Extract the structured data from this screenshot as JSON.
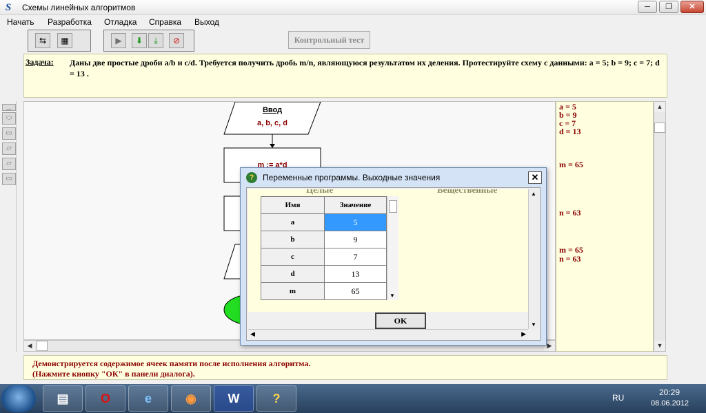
{
  "window": {
    "title": "Схемы линейных алгоритмов",
    "icon_glyph": "S",
    "minimize": "─",
    "maximize": "❐",
    "close": "✕"
  },
  "menu": [
    "Начать",
    "Разработка",
    "Отладка",
    "Справка",
    "Выход"
  ],
  "toolbar": {
    "control_test_label": "Контрольный тест",
    "icons": [
      "edit-properties-icon",
      "delete-icon",
      "run-icon",
      "step-into-icon",
      "step-over-icon",
      "stop-icon"
    ]
  },
  "task": {
    "label": "Задача:",
    "text": "Даны две простые дроби a/b и c/d. Требуется получить дробь m/n, являющуюся результатом их деления.      Протестируйте схему с данными: a = 5;  b = 9;  c = 7;  d = 13 ."
  },
  "flowchart": {
    "input_title": "Ввод",
    "input_vars": "a, b, c, d",
    "assign_m": "m := a*d"
  },
  "right_panel": {
    "a": "a = 5",
    "b": "b = 9",
    "c": "c = 7",
    "d": "d = 13",
    "m": "m = 65",
    "n": "n = 63",
    "m2": "m = 65",
    "n2": "n = 63"
  },
  "status": {
    "line1": "Демонстрируется содержимое ячеек памяти после исполнения алгоритма.",
    "line2": "(Нажмите кнопку \"ОК\" в панели диалога)."
  },
  "dialog": {
    "title": "Переменные программы. Выходные значения",
    "close": "✕",
    "group_int": "Целые",
    "group_real": "Вещественные",
    "col_name": "Имя",
    "col_value": "Значение",
    "rows": [
      {
        "name": "a",
        "value": "5"
      },
      {
        "name": "b",
        "value": "9"
      },
      {
        "name": "c",
        "value": "7"
      },
      {
        "name": "d",
        "value": "13"
      },
      {
        "name": "m",
        "value": "65"
      }
    ],
    "ok": "OK"
  },
  "taskbar": {
    "lang": "RU",
    "time": "20:29",
    "date": "08.06.2012",
    "apps": [
      "explorer-icon",
      "opera-icon",
      "internet-explorer-icon",
      "firefox-icon",
      "word-icon",
      "algorithm-app-icon"
    ]
  }
}
